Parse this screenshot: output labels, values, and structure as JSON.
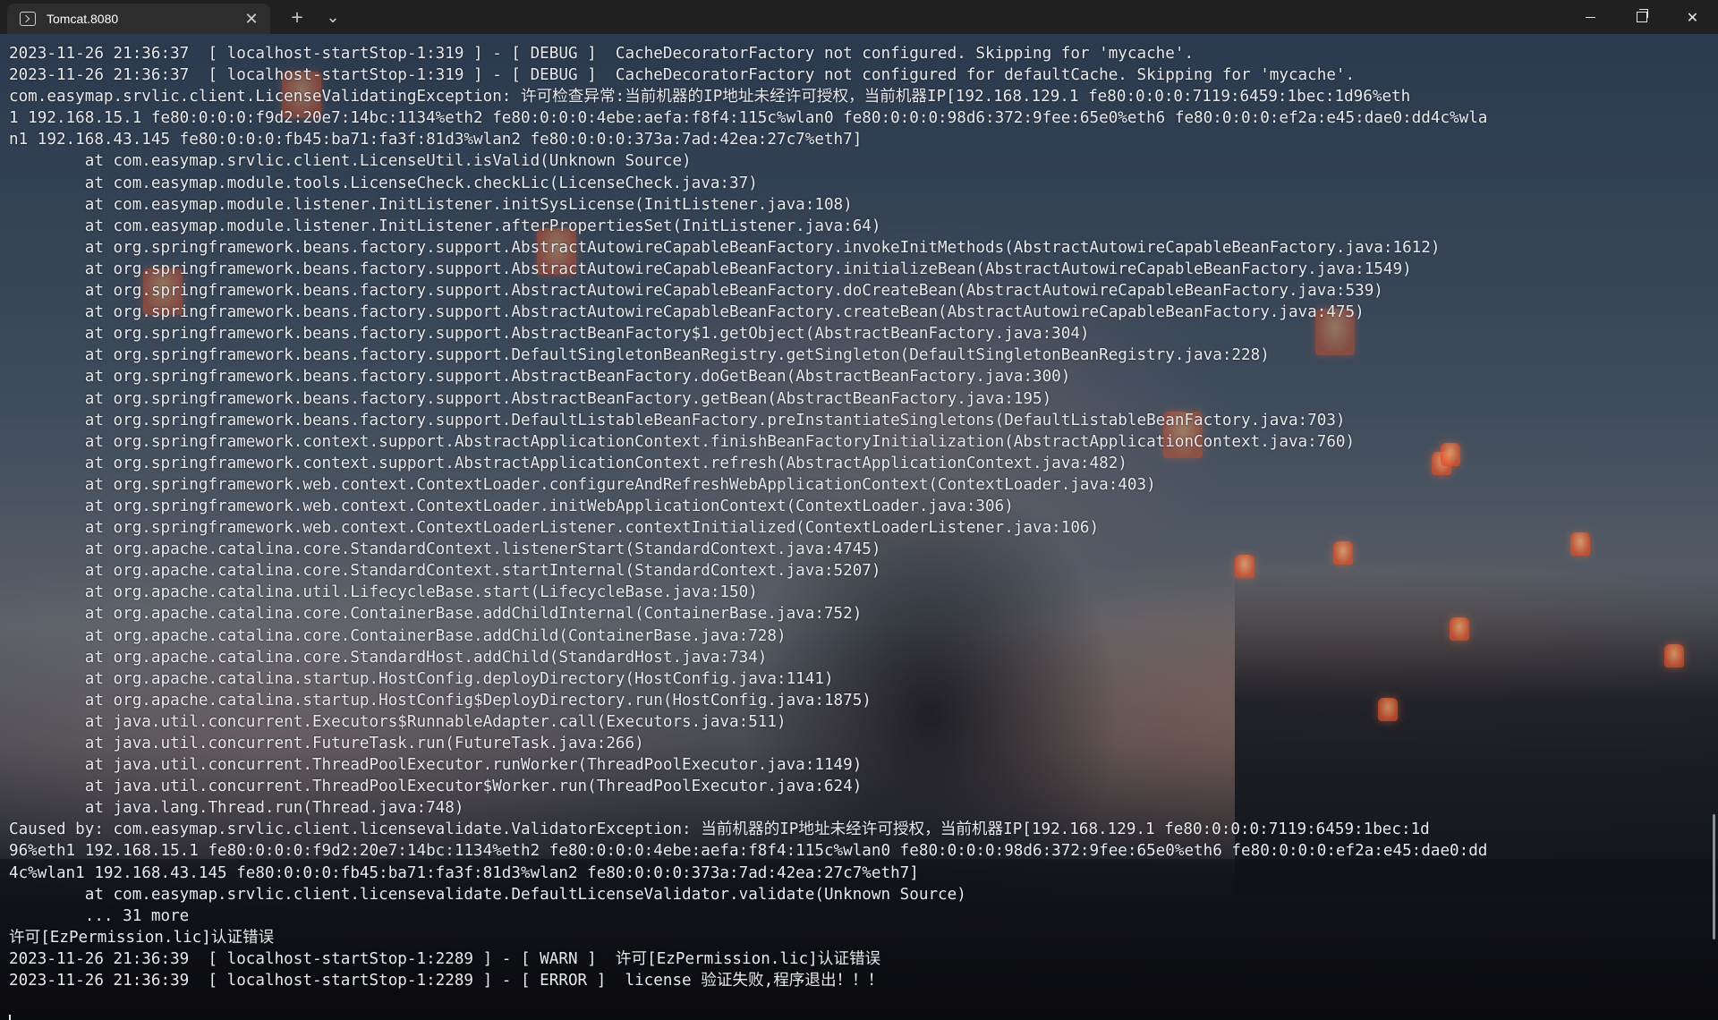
{
  "window": {
    "tab_title": "Tomcat.8080",
    "tab_close": "✕",
    "new_tab": "+",
    "dropdown": "⌄",
    "close": "✕"
  },
  "terminal": {
    "lines": [
      "2023-11-26 21:36:37  [ localhost-startStop-1:319 ] - [ DEBUG ]  CacheDecoratorFactory not configured. Skipping for 'mycache'.",
      "2023-11-26 21:36:37  [ localhost-startStop-1:319 ] - [ DEBUG ]  CacheDecoratorFactory not configured for defaultCache. Skipping for 'mycache'.",
      "com.easymap.srvlic.client.LicenseValidatingException: 许可检查异常:当前机器的IP地址未经许可授权，当前机器IP[192.168.129.1 fe80:0:0:0:7119:6459:1bec:1d96%eth",
      "1 192.168.15.1 fe80:0:0:0:f9d2:20e7:14bc:1134%eth2 fe80:0:0:0:4ebe:aefa:f8f4:115c%wlan0 fe80:0:0:0:98d6:372:9fee:65e0%eth6 fe80:0:0:0:ef2a:e45:dae0:dd4c%wla",
      "n1 192.168.43.145 fe80:0:0:0:fb45:ba71:fa3f:81d3%wlan2 fe80:0:0:0:373a:7ad:42ea:27c7%eth7]",
      "        at com.easymap.srvlic.client.LicenseUtil.isValid(Unknown Source)",
      "        at com.easymap.module.tools.LicenseCheck.checkLic(LicenseCheck.java:37)",
      "        at com.easymap.module.listener.InitListener.initSysLicense(InitListener.java:108)",
      "        at com.easymap.module.listener.InitListener.afterPropertiesSet(InitListener.java:64)",
      "        at org.springframework.beans.factory.support.AbstractAutowireCapableBeanFactory.invokeInitMethods(AbstractAutowireCapableBeanFactory.java:1612)",
      "        at org.springframework.beans.factory.support.AbstractAutowireCapableBeanFactory.initializeBean(AbstractAutowireCapableBeanFactory.java:1549)",
      "        at org.springframework.beans.factory.support.AbstractAutowireCapableBeanFactory.doCreateBean(AbstractAutowireCapableBeanFactory.java:539)",
      "        at org.springframework.beans.factory.support.AbstractAutowireCapableBeanFactory.createBean(AbstractAutowireCapableBeanFactory.java:475)",
      "        at org.springframework.beans.factory.support.AbstractBeanFactory$1.getObject(AbstractBeanFactory.java:304)",
      "        at org.springframework.beans.factory.support.DefaultSingletonBeanRegistry.getSingleton(DefaultSingletonBeanRegistry.java:228)",
      "        at org.springframework.beans.factory.support.AbstractBeanFactory.doGetBean(AbstractBeanFactory.java:300)",
      "        at org.springframework.beans.factory.support.AbstractBeanFactory.getBean(AbstractBeanFactory.java:195)",
      "        at org.springframework.beans.factory.support.DefaultListableBeanFactory.preInstantiateSingletons(DefaultListableBeanFactory.java:703)",
      "        at org.springframework.context.support.AbstractApplicationContext.finishBeanFactoryInitialization(AbstractApplicationContext.java:760)",
      "        at org.springframework.context.support.AbstractApplicationContext.refresh(AbstractApplicationContext.java:482)",
      "        at org.springframework.web.context.ContextLoader.configureAndRefreshWebApplicationContext(ContextLoader.java:403)",
      "        at org.springframework.web.context.ContextLoader.initWebApplicationContext(ContextLoader.java:306)",
      "        at org.springframework.web.context.ContextLoaderListener.contextInitialized(ContextLoaderListener.java:106)",
      "        at org.apache.catalina.core.StandardContext.listenerStart(StandardContext.java:4745)",
      "        at org.apache.catalina.core.StandardContext.startInternal(StandardContext.java:5207)",
      "        at org.apache.catalina.util.LifecycleBase.start(LifecycleBase.java:150)",
      "        at org.apache.catalina.core.ContainerBase.addChildInternal(ContainerBase.java:752)",
      "        at org.apache.catalina.core.ContainerBase.addChild(ContainerBase.java:728)",
      "        at org.apache.catalina.core.StandardHost.addChild(StandardHost.java:734)",
      "        at org.apache.catalina.startup.HostConfig.deployDirectory(HostConfig.java:1141)",
      "        at org.apache.catalina.startup.HostConfig$DeployDirectory.run(HostConfig.java:1875)",
      "        at java.util.concurrent.Executors$RunnableAdapter.call(Executors.java:511)",
      "        at java.util.concurrent.FutureTask.run(FutureTask.java:266)",
      "        at java.util.concurrent.ThreadPoolExecutor.runWorker(ThreadPoolExecutor.java:1149)",
      "        at java.util.concurrent.ThreadPoolExecutor$Worker.run(ThreadPoolExecutor.java:624)",
      "        at java.lang.Thread.run(Thread.java:748)",
      "Caused by: com.easymap.srvlic.client.licensevalidate.ValidatorException: 当前机器的IP地址未经许可授权，当前机器IP[192.168.129.1 fe80:0:0:0:7119:6459:1bec:1d",
      "96%eth1 192.168.15.1 fe80:0:0:0:f9d2:20e7:14bc:1134%eth2 fe80:0:0:0:4ebe:aefa:f8f4:115c%wlan0 fe80:0:0:0:98d6:372:9fee:65e0%eth6 fe80:0:0:0:ef2a:e45:dae0:dd",
      "4c%wlan1 192.168.43.145 fe80:0:0:0:fb45:ba71:fa3f:81d3%wlan2 fe80:0:0:0:373a:7ad:42ea:27c7%eth7]",
      "        at com.easymap.srvlic.client.licensevalidate.DefaultLicenseValidator.validate(Unknown Source)",
      "        ... 31 more",
      "许可[EzPermission.lic]认证错误",
      "2023-11-26 21:36:39  [ localhost-startStop-1:2289 ] - [ WARN ]  许可[EzPermission.lic]认证错误",
      "2023-11-26 21:36:39  [ localhost-startStop-1:2289 ] - [ ERROR ]  license 验证失败,程序退出！！！"
    ]
  }
}
